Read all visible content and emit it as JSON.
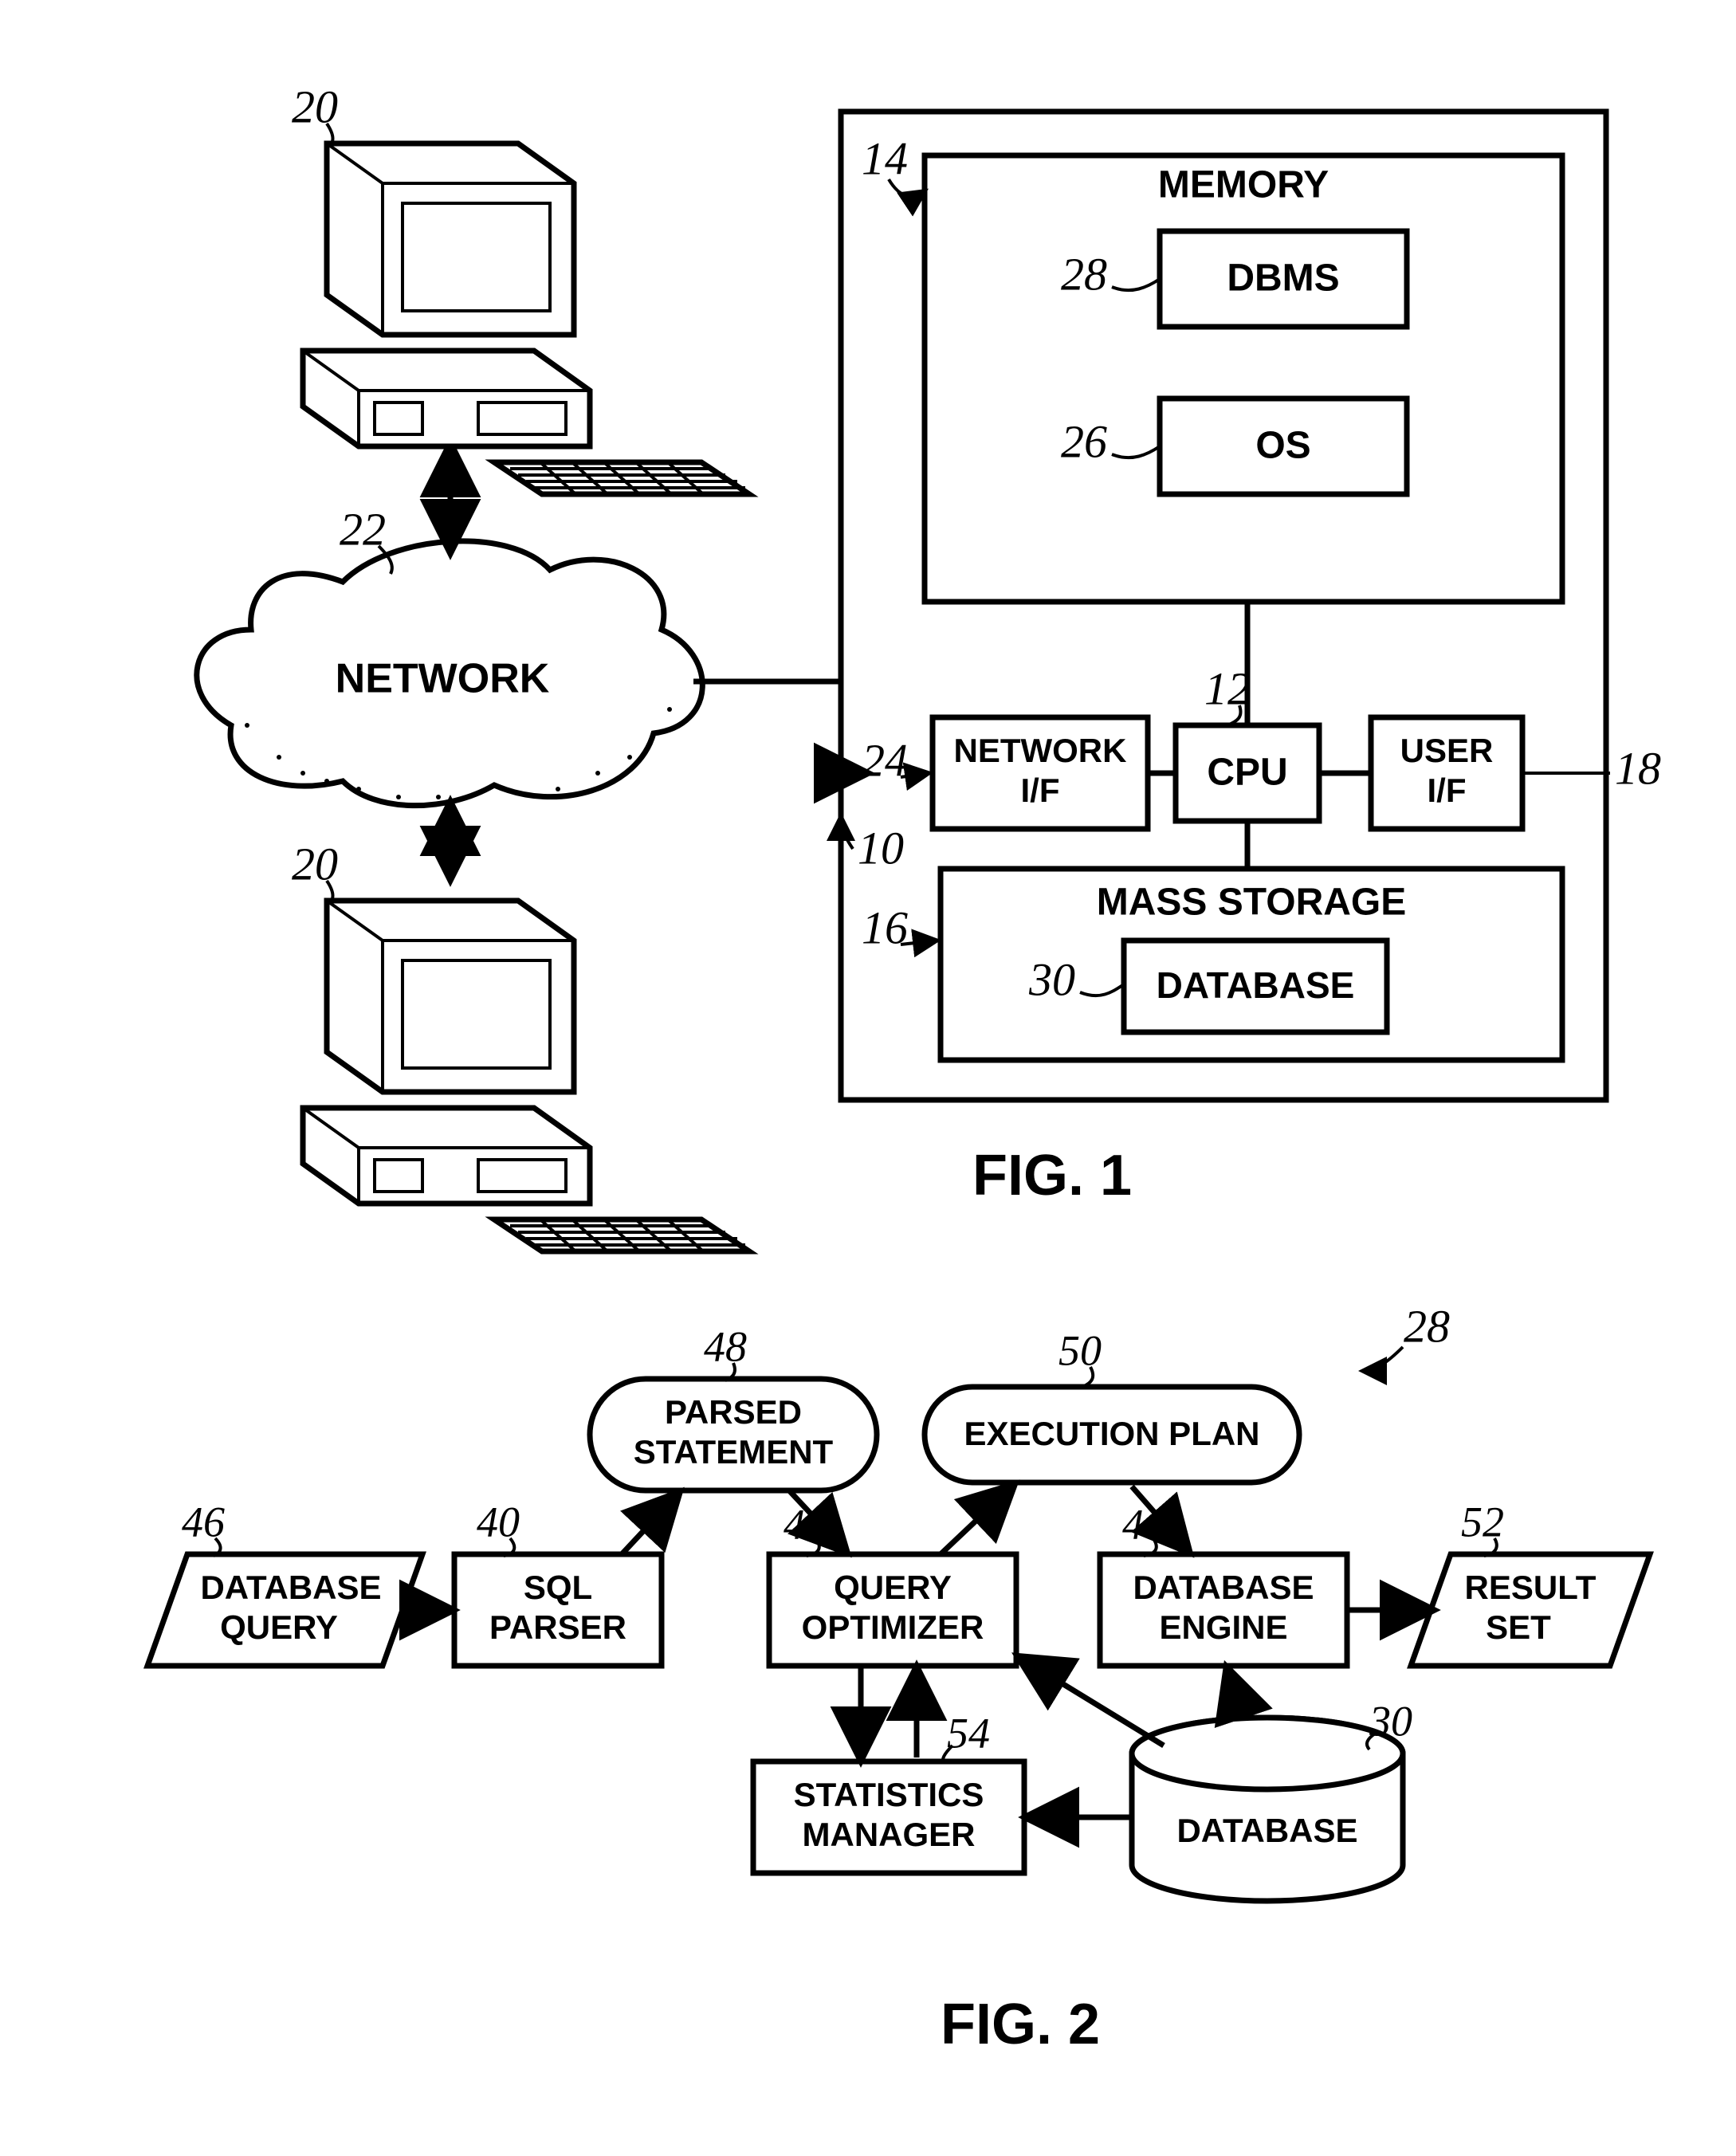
{
  "fig1": {
    "caption": "FIG. 1",
    "refs": {
      "client_top": "20",
      "client_bottom": "20",
      "network": "22",
      "system": "10",
      "memory": "14",
      "cpu": "12",
      "mass_storage": "16",
      "user_if": "18",
      "network_if": "24",
      "os": "26",
      "dbms": "28",
      "database": "30"
    },
    "labels": {
      "network": "NETWORK",
      "memory": "MEMORY",
      "dbms": "DBMS",
      "os": "OS",
      "network_if_l1": "NETWORK",
      "network_if_l2": "I/F",
      "cpu": "CPU",
      "user_if_l1": "USER",
      "user_if_l2": "I/F",
      "mass_storage": "MASS STORAGE",
      "database": "DATABASE"
    }
  },
  "fig2": {
    "caption": "FIG. 2",
    "refs": {
      "dbms_ptr": "28",
      "database_query": "46",
      "sql_parser": "40",
      "parsed_statement": "48",
      "query_optimizer": "42",
      "execution_plan": "50",
      "database_engine": "44",
      "result_set": "52",
      "statistics_manager": "54",
      "database": "30"
    },
    "labels": {
      "database_query_l1": "DATABASE",
      "database_query_l2": "QUERY",
      "sql_parser_l1": "SQL",
      "sql_parser_l2": "PARSER",
      "parsed_statement_l1": "PARSED",
      "parsed_statement_l2": "STATEMENT",
      "query_optimizer_l1": "QUERY",
      "query_optimizer_l2": "OPTIMIZER",
      "execution_plan": "EXECUTION PLAN",
      "database_engine_l1": "DATABASE",
      "database_engine_l2": "ENGINE",
      "result_set_l1": "RESULT",
      "result_set_l2": "SET",
      "statistics_manager_l1": "STATISTICS",
      "statistics_manager_l2": "MANAGER",
      "database": "DATABASE"
    }
  }
}
